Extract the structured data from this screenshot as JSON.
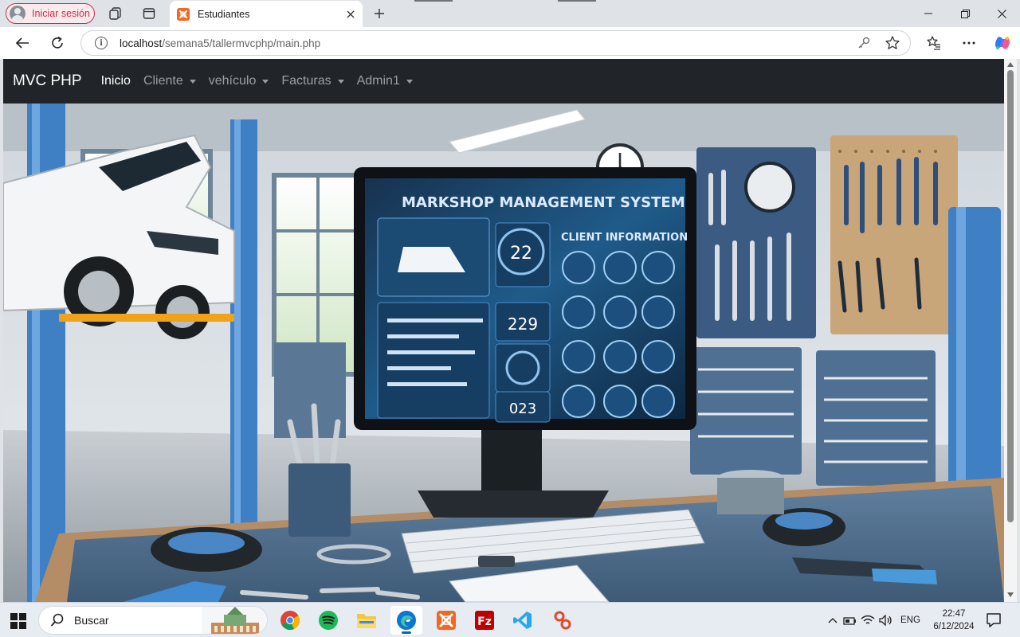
{
  "browser": {
    "profile_label": "Iniciar sesión",
    "tab_title": "Estudiantes",
    "url_host": "localhost",
    "url_path": "/semana5/tallermvcphp/main.php"
  },
  "navbar": {
    "brand": "MVC PHP",
    "items": [
      {
        "label": "Inicio",
        "dropdown": false,
        "active": true
      },
      {
        "label": "Cliente",
        "dropdown": true,
        "active": false
      },
      {
        "label": "vehículo",
        "dropdown": true,
        "active": false
      },
      {
        "label": "Facturas",
        "dropdown": true,
        "active": false
      },
      {
        "label": "Admin1",
        "dropdown": true,
        "active": false
      }
    ]
  },
  "hero": {
    "screen_title": "MARKSHOP MANAGEMENT SYSTEM",
    "screen_subtitle": "CLIENT INFORMATION",
    "gauge_values": [
      "22",
      "229",
      "023"
    ]
  },
  "taskbar": {
    "search_label": "Buscar",
    "apps": [
      "chrome-icon",
      "spotify-icon",
      "file-explorer-icon",
      "edge-icon",
      "xampp-icon",
      "filezilla-icon",
      "vscode-icon",
      "git-tool-icon"
    ],
    "language": "ENG",
    "time": "22:47",
    "date": "6/12/2024"
  },
  "colors": {
    "navbar_bg": "#212529",
    "profile_accent": "#c4314b",
    "xampp_orange": "#f26722",
    "taskbar_bg": "#e7ecf3"
  }
}
